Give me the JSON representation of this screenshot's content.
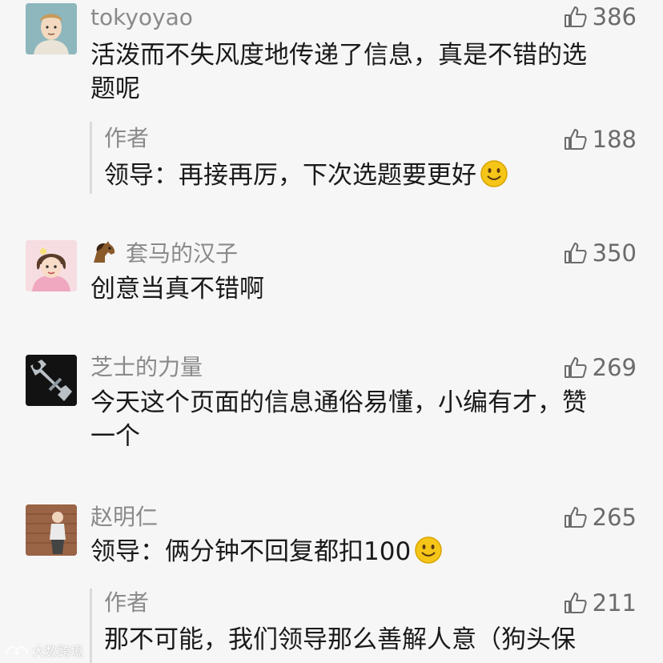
{
  "comments": [
    {
      "username": "tokyoyao",
      "likes": "386",
      "text_line1": "活泼而不失风度地传递了信息，真是不错的选",
      "text_line2": "题呢",
      "reply": {
        "author": "作者",
        "likes": "188",
        "text": "领导：再接再厉，下次选题要更好"
      }
    },
    {
      "username": "套马的汉子",
      "likes": "350",
      "text_line1": "创意当真不错啊"
    },
    {
      "username": "芝士的力量",
      "likes": "269",
      "text_line1": "今天这个页面的信息通俗易懂，小编有才，赞",
      "text_line2": "一个"
    },
    {
      "username": "赵明仁",
      "likes": "265",
      "text_line1": "领导：俩分钟不回复都扣100",
      "reply": {
        "author": "作者",
        "likes": "211",
        "text": "那不可能，我们领导那么善解人意（狗头保"
      }
    }
  ],
  "watermark": "大数跨境",
  "icons": {
    "like": "thumbs-up-icon",
    "smile": "smile-emoji-icon",
    "horse": "horse-emoji-icon"
  },
  "colors": {
    "background": "#f6f6f6",
    "username": "#8a8a8a",
    "text": "#1a1a1a",
    "reply_bar": "#dadada",
    "emoji": "#f5c518"
  }
}
